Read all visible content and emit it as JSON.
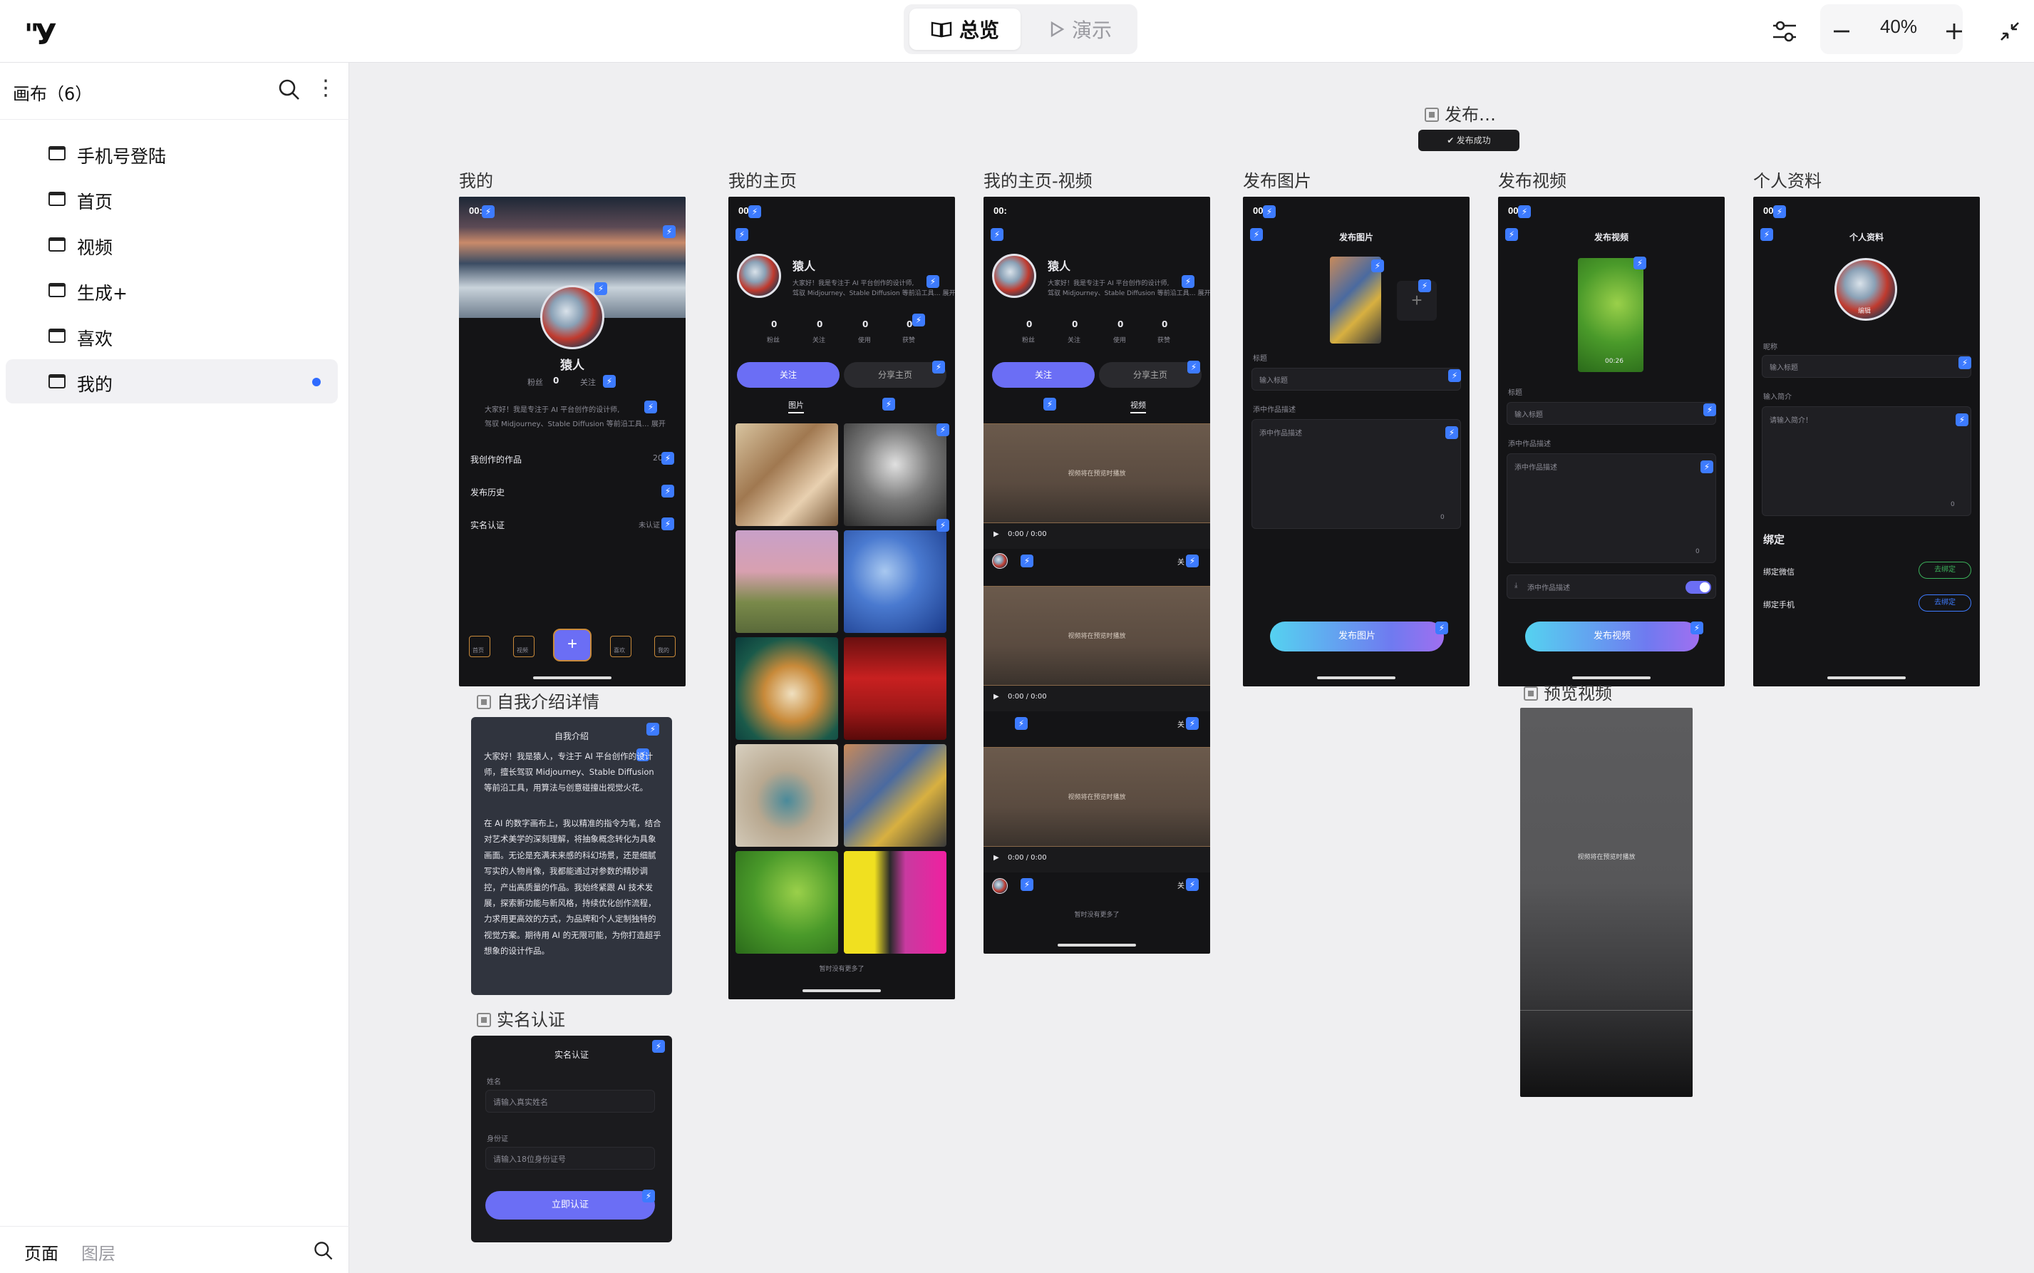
{
  "topbar": {
    "logo": "\"У",
    "mode_overview": "总览",
    "mode_present": "演示",
    "zoom_level": "40%"
  },
  "sidebar": {
    "title": "画布（6）",
    "items": [
      {
        "label": "手机号登陆"
      },
      {
        "label": "首页"
      },
      {
        "label": "视频"
      },
      {
        "label": "生成+"
      },
      {
        "label": "喜欢"
      },
      {
        "label": "我的"
      }
    ],
    "footer_tab_pages": "页面",
    "footer_tab_layers": "图层"
  },
  "frames": {
    "publish_toast_label": "发布…",
    "publish_toast_text": "✔ 发布成功",
    "mine_label": "我的",
    "home_label": "我的主页",
    "home_video_label": "我的主页-视频",
    "post_image_label": "发布图片",
    "post_video_label": "发布视频",
    "profile_label": "个人资料",
    "intro_label": "自我介绍详情",
    "realname_label": "实名认证",
    "preview_label": "预览视频"
  },
  "mine": {
    "time": "00:",
    "name": "猿人",
    "fans_label": "粉丝",
    "fans_value": "0",
    "follow_label": "关注",
    "bio": "大家好！我是专注于 AI 平台创作的设计师,",
    "bio2": "驾驭 Midjourney、Stable Diffusion 等前沿工具… 展开",
    "row1": "我创作的作品",
    "row1_val": "20",
    "row2": "发布历史",
    "row3": "实名认证",
    "row3_val": "未认证",
    "tabs": [
      "首页",
      "视频",
      "+",
      "喜欢",
      "我的"
    ]
  },
  "home": {
    "name": "猿人",
    "bio": "大家好！我是专注于 AI 平台创作的设计师,",
    "bio2": "驾驭 Midjourney、Stable Diffusion 等前沿工具… 展开",
    "stats": [
      {
        "value": "0",
        "label": "粉丝"
      },
      {
        "value": "0",
        "label": "关注"
      },
      {
        "value": "0",
        "label": "使用"
      },
      {
        "value": "0",
        "label": "获赞"
      }
    ],
    "btn_follow": "关注",
    "btn_share": "分享主页",
    "tab_images": "图片",
    "tab_videos": "视频",
    "footer": "暂时没有更多了"
  },
  "video_page": {
    "placeholder": "视频将在预览时播放",
    "time": "0:00 / 0:00",
    "follow": "关",
    "footer": "暂时没有更多了"
  },
  "post_image": {
    "title": "发布图片",
    "title_label": "标题",
    "title_placeholder": "输入标题",
    "desc_label": "添中作品描述",
    "desc_placeholder": "添中作品描述",
    "counter": "0",
    "button": "发布图片"
  },
  "post_video": {
    "title": "发布视频",
    "duration": "00:26",
    "title_label": "标题",
    "title_placeholder": "输入标题",
    "desc_label": "添中作品描述",
    "desc_placeholder": "添中作品描述",
    "counter": "0",
    "download_label": "添中作品描述",
    "button": "发布视频"
  },
  "profile": {
    "title": "个人资料",
    "edit": "编辑",
    "nick_label": "昵称",
    "nick_placeholder": "输入标题",
    "intro_label": "输入简介",
    "intro_placeholder": "请输入简介！",
    "counter": "0",
    "bind_title": "绑定",
    "bind_wechat": "绑定微信",
    "bind_phone": "绑定手机",
    "bind_btn": "去绑定"
  },
  "intro": {
    "title": "自我介绍",
    "para1": "大家好！我是猿人，专注于 AI 平台创作的设计师，擅长驾驭 Midjourney、Stable Diffusion 等前沿工具，用算法与创意碰撞出视觉火花。",
    "para2": "在 AI 的数字画布上，我以精准的指令为笔，结合对艺术美学的深刻理解，将抽象概念转化为具象画面。无论是充满未来感的科幻场景，还是细腻写实的人物肖像，我都能通过对参数的精妙调控，产出高质量的作品。我始终紧跟 AI 技术发展，探索新功能与新风格，持续优化创作流程，力求用更高效的方式，为品牌和个人定制独特的视觉方案。期待用 AI 的无限可能，为你打造超乎想象的设计作品。"
  },
  "realname": {
    "title": "实名认证",
    "name_label": "姓名",
    "name_placeholder": "请输入真实姓名",
    "id_label": "身份证",
    "id_placeholder": "请输入18位身份证号",
    "button": "立即认证"
  },
  "preview": {
    "placeholder": "视频将在预览时播放"
  },
  "colors": {
    "accent": "#6b6ef5",
    "accent_blue": "#3d7bff",
    "active_dot": "#2f6bff",
    "phone_bg": "#141416"
  }
}
